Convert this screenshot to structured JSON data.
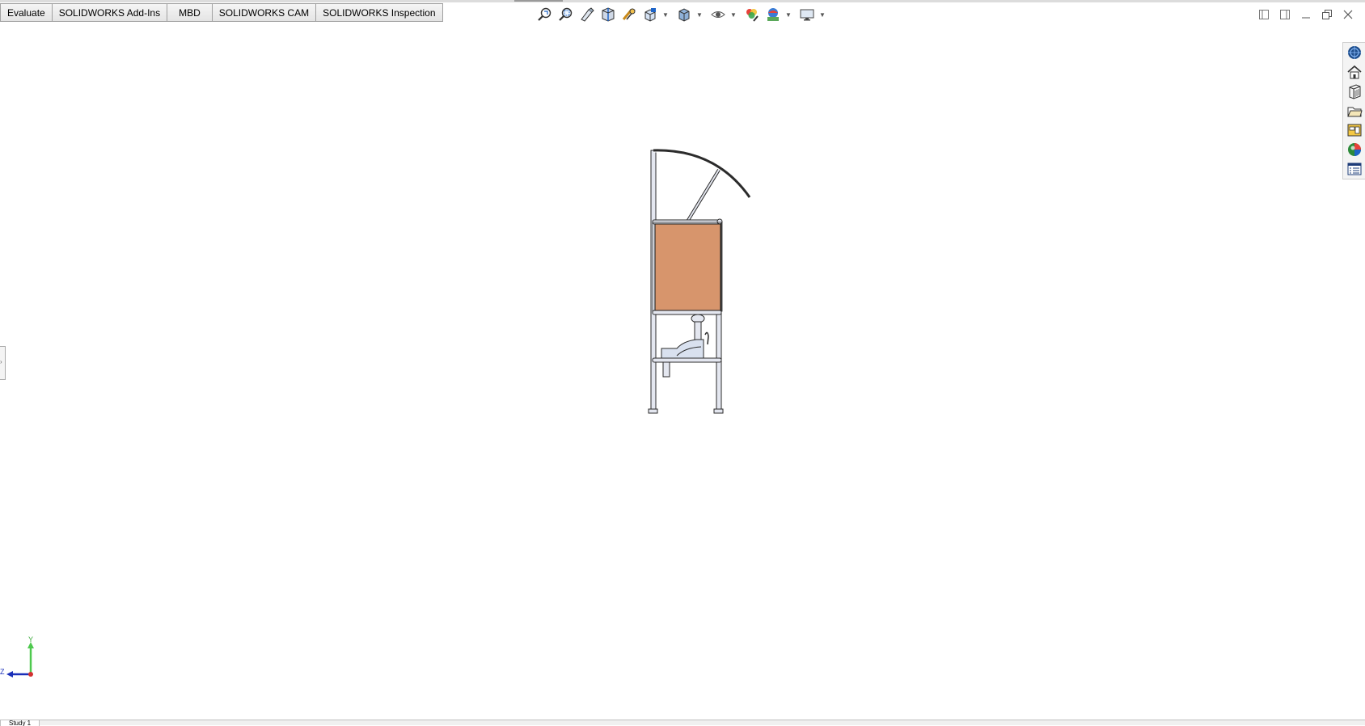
{
  "tabs": [
    "Evaluate",
    "SOLIDWORKS Add-Ins",
    "MBD",
    "SOLIDWORKS CAM",
    "SOLIDWORKS Inspection"
  ],
  "hud_icons": [
    "zoom-to-fit-icon",
    "zoom-to-area-icon",
    "previous-view-icon",
    "section-view-icon",
    "dynamic-annotation-icon",
    "view-orientation-icon",
    "display-style-icon",
    "hide-show-items-icon",
    "edit-appearance-icon",
    "apply-scene-icon",
    "view-settings-icon"
  ],
  "window_controls": [
    "tile-left-icon",
    "tile-right-icon",
    "minimize-icon",
    "restore-icon",
    "close-icon"
  ],
  "task_pane": [
    "solidworks-resources-icon",
    "design-library-icon",
    "file-explorer-icon",
    "view-palette-icon",
    "appearances-scenes-icon",
    "custom-properties-icon"
  ],
  "triad": {
    "y": "Y",
    "z": "Z"
  },
  "status": {
    "sheet": "Study 1"
  },
  "colors": {
    "panel": "#d7956c",
    "frame": "#e4e7f0",
    "outline": "#2b2b2b"
  }
}
